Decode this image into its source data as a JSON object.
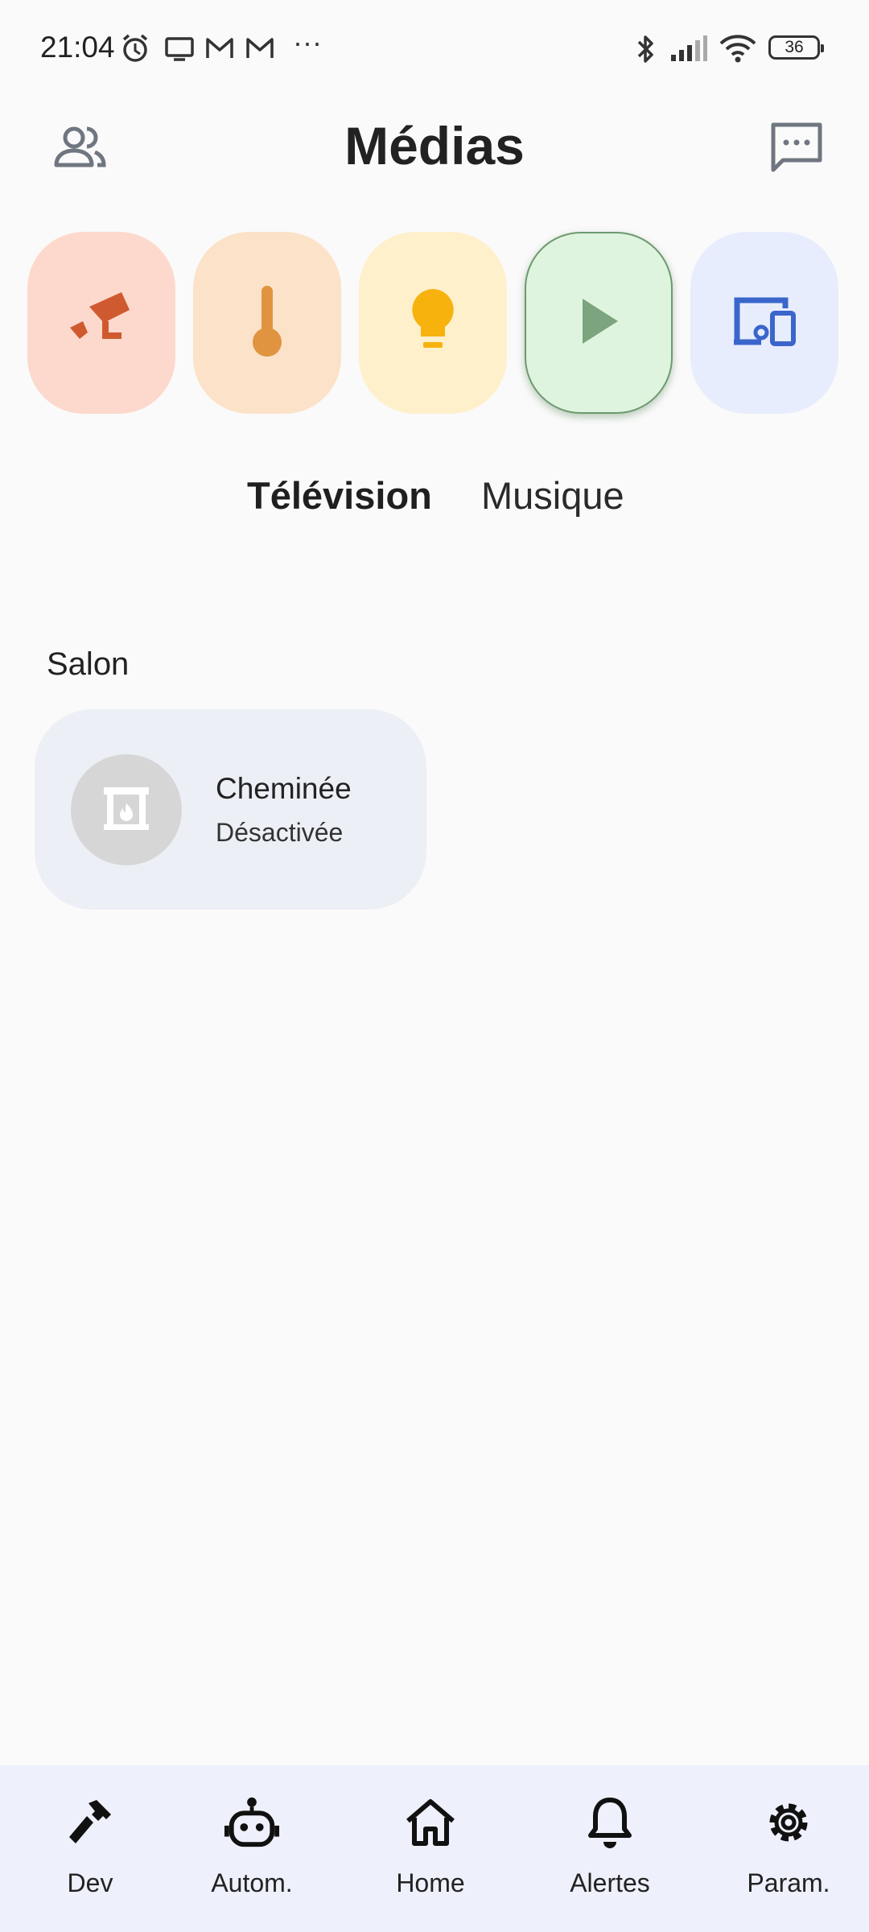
{
  "status_bar": {
    "time": "21:04",
    "more": "···",
    "battery": "36",
    "icons": [
      "alarm-icon",
      "screen-icon",
      "gmail-icon",
      "gmail-icon",
      "bluetooth-icon",
      "signal-icon",
      "wifi-icon"
    ]
  },
  "header": {
    "title": "Médias",
    "left_icon": "people-icon",
    "right_icon": "message-icon"
  },
  "categories": [
    {
      "name": "Caméras",
      "icon": "camera-icon",
      "bg": "#fdd9cd",
      "fg": "#d05a2f"
    },
    {
      "name": "Climat",
      "icon": "thermometer-icon",
      "bg": "#fbe2c8",
      "fg": "#e0943f"
    },
    {
      "name": "Éclairage",
      "icon": "lightbulb-icon",
      "bg": "#fff0cc",
      "fg": "#f7b20e"
    },
    {
      "name": "Médias",
      "icon": "play-icon",
      "bg": "#dff4de",
      "fg": "#7ba47f",
      "selected": true
    },
    {
      "name": "Appareils",
      "icon": "devices-icon",
      "bg": "#e8edfd",
      "fg": "#3a66cc"
    }
  ],
  "tabs": {
    "television": "Télévision",
    "music": "Musique",
    "active": "television"
  },
  "room": {
    "title": "Salon",
    "devices": [
      {
        "name": "Cheminée",
        "state": "Désactivée",
        "icon": "fireplace-icon"
      }
    ]
  },
  "bottom_nav": [
    {
      "label": "Dev",
      "icon": "hammer-icon"
    },
    {
      "label": "Autom.",
      "icon": "robot-icon"
    },
    {
      "label": "Home",
      "icon": "home-icon"
    },
    {
      "label": "Alertes",
      "icon": "bell-icon"
    },
    {
      "label": "Param.",
      "icon": "gear-icon"
    }
  ]
}
